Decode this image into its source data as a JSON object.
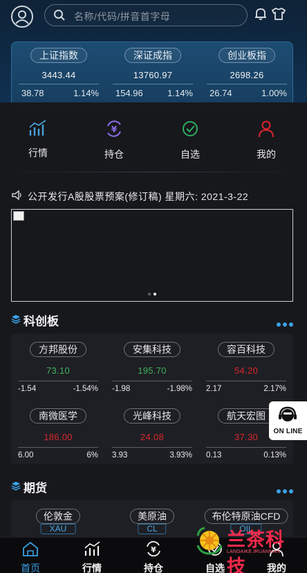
{
  "header": {
    "search_placeholder": "名称/代码/拼音首字母"
  },
  "indices": [
    {
      "name": "上证指数",
      "value": "3443.44",
      "change": "38.78",
      "pct": "1.14%"
    },
    {
      "name": "深证成指",
      "value": "13760.97",
      "change": "154.96",
      "pct": "1.14%"
    },
    {
      "name": "创业板指",
      "value": "2698.26",
      "change": "26.74",
      "pct": "1.00%"
    }
  ],
  "quick_nav": [
    {
      "label": "行情",
      "icon": "chart-icon"
    },
    {
      "label": "持仓",
      "icon": "yuan-exchange-icon"
    },
    {
      "label": "自选",
      "icon": "check-circle-icon"
    },
    {
      "label": "我的",
      "icon": "person-icon"
    }
  ],
  "notice": {
    "text": "公开发行A股股票预案(修订稿)   星期六: 2021-3-22"
  },
  "sections": {
    "star_market": {
      "title": "科创板",
      "stocks": [
        {
          "name": "方邦股份",
          "price": "73.10",
          "change": "-1.54",
          "pct": "-1.54%",
          "trend": "down"
        },
        {
          "name": "安集科技",
          "price": "195.70",
          "change": "-1.98",
          "pct": "-1.98%",
          "trend": "down"
        },
        {
          "name": "容百科技",
          "price": "54.20",
          "change": "2.17",
          "pct": "2.17%",
          "trend": "up"
        },
        {
          "name": "南微医学",
          "price": "186.00",
          "change": "6.00",
          "pct": "6%",
          "trend": "up"
        },
        {
          "name": "光峰科技",
          "price": "24.08",
          "change": "3.93",
          "pct": "3.93%",
          "trend": "up"
        },
        {
          "name": "航天宏图",
          "price": "37.30",
          "change": "0.13",
          "pct": "0.13%",
          "trend": "up"
        }
      ]
    },
    "futures": {
      "title": "期货",
      "items": [
        {
          "name": "伦敦金",
          "code": "XAU"
        },
        {
          "name": "美原油",
          "code": "CL"
        },
        {
          "name": "布伦特原油CFD",
          "code": "OIL"
        }
      ]
    }
  },
  "online_service": {
    "label": "ON LINE"
  },
  "tabbar": [
    {
      "label": "首页",
      "icon": "home-icon",
      "active": true
    },
    {
      "label": "行情",
      "icon": "chart-icon",
      "active": false
    },
    {
      "label": "持仓",
      "icon": "yuan-exchange-icon",
      "active": false
    },
    {
      "label": "自选",
      "icon": "check-circle-icon",
      "active": false
    },
    {
      "label": "我的",
      "icon": "person-icon",
      "active": false
    }
  ],
  "watermark": {
    "title": "兰茶科技",
    "subtitle": "LANDAIKE.IRUANMAN"
  },
  "colors": {
    "up": "#d8262c",
    "down": "#3fb25c",
    "accent": "#3a9fe4"
  }
}
